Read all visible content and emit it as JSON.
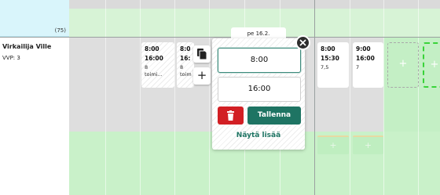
{
  "header": {
    "count_label": "(75)"
  },
  "employee": {
    "name": "Virkailija Ville",
    "vvp_label": "VVP: 3"
  },
  "shifts": [
    {
      "start": "8:00",
      "end": "16:00",
      "hours": "8",
      "note": "toimi..."
    },
    {
      "start": "8:0",
      "end": "16:",
      "hours": "8",
      "note": "toim"
    },
    {
      "start": "8:00",
      "end": "15:30",
      "hours": "7,5",
      "note": ""
    },
    {
      "start": "9:00",
      "end": "16:00",
      "hours": "7",
      "note": ""
    }
  ],
  "add_symbol": "+",
  "popup": {
    "date_label": "pe 16.2.",
    "start_time": "8:00",
    "end_time": "16:00",
    "save_label": "Tallenna",
    "more_label": "Näytä lisää"
  },
  "icons": {
    "copy": "copy-icon",
    "add": "plus-icon",
    "delete": "trash-icon",
    "close": "close-icon"
  },
  "colors": {
    "accent": "#1e7463",
    "danger": "#d21f24",
    "weekend_green": "#c4efc5",
    "header_blue": "#d9f5fb"
  }
}
